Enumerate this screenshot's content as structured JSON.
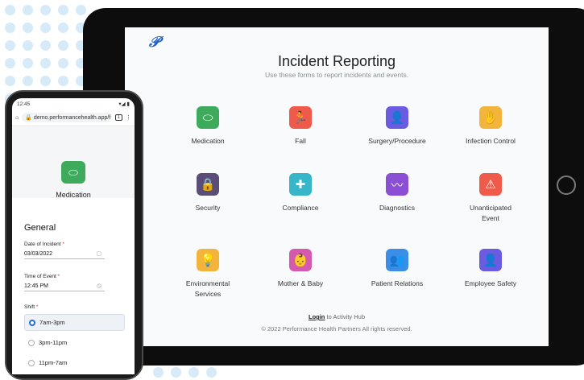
{
  "tablet": {
    "header": {
      "title": "Incident Reporting",
      "subtitle": "Use these forms to report incidents and events."
    },
    "forms": [
      {
        "label": "Medication",
        "icon": "pill-icon",
        "color": "#3daa5c"
      },
      {
        "label": "Fall",
        "icon": "fall-icon",
        "color": "#ef5a4a"
      },
      {
        "label": "Surgery/Procedure",
        "icon": "surgeon-icon",
        "color": "#6b5be0"
      },
      {
        "label": "Infection Control",
        "icon": "hands-icon",
        "color": "#f3b43b"
      },
      {
        "label": "Security",
        "icon": "lock-icon",
        "color": "#5a4e78"
      },
      {
        "label": "Compliance",
        "icon": "shield-icon",
        "color": "#36b6c8"
      },
      {
        "label": "Diagnostics",
        "icon": "monitor-icon",
        "color": "#8b4fd6"
      },
      {
        "label": "Unanticipated Event",
        "icon": "warning-icon",
        "color": "#ef5a4a"
      },
      {
        "label": "Environmental Services",
        "icon": "lightbulb-icon",
        "color": "#f3b43b"
      },
      {
        "label": "Mother & Baby",
        "icon": "mother-baby-icon",
        "color": "#d659b0"
      },
      {
        "label": "Patient Relations",
        "icon": "people-icon",
        "color": "#3a8ee6"
      },
      {
        "label": "Employee Safety",
        "icon": "person-icon",
        "color": "#6b5be0"
      }
    ],
    "footer": {
      "login_link": "Login",
      "login_rest": " to Activity Hub",
      "copyright": "© 2022 Performance Health Partners All rights reserved."
    }
  },
  "phone": {
    "status": {
      "time": "12:45",
      "signal": "▾◢ ▮"
    },
    "browser": {
      "url": "demo.performancehealth.app/f",
      "tabs": "1"
    },
    "form_name": "Medication",
    "section": "General",
    "fields": {
      "date_label": "Date of Incident",
      "date_value": "03/03/2022",
      "time_label": "Time of Event",
      "time_value": "12:45 PM",
      "shift_label": "Shift",
      "required_mark": "*"
    },
    "shift_options": [
      {
        "label": "7am-3pm",
        "selected": true
      },
      {
        "label": "3pm-11pm",
        "selected": false
      },
      {
        "label": "11pm-7am",
        "selected": false
      }
    ]
  },
  "colors": {
    "accent": "#1d6fe0",
    "logo": "#1e5fc4"
  }
}
